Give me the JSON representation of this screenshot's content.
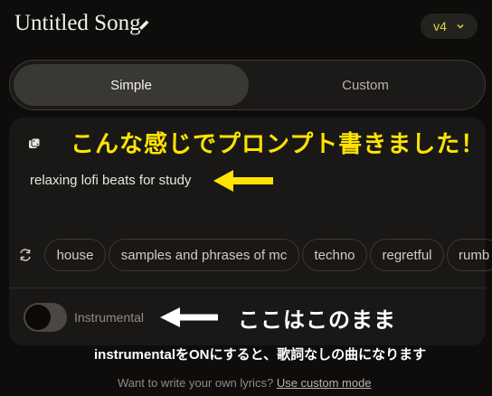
{
  "header": {
    "song_title": "Untitled Song",
    "edit_icon": "pencil-icon",
    "version": "v4",
    "version_icon": "chevron-down-icon"
  },
  "mode_tabs": {
    "simple_label": "Simple",
    "custom_label": "Custom",
    "active": "Simple"
  },
  "prompt": {
    "dice_icon": "dice-icon",
    "text": "relaxing lofi beats for study"
  },
  "style_tags": {
    "refresh_icon": "refresh-icon",
    "items": [
      "house",
      "samples and phrases of mc",
      "techno",
      "regretful",
      "rumb"
    ]
  },
  "instrumental": {
    "label": "Instrumental",
    "enabled": false
  },
  "footer": {
    "question": "Want to write your own lyrics?",
    "link": "Use custom mode"
  },
  "annotations": {
    "main": "こんな感じでプロンプト書きました！",
    "keep": "ここはこのまま",
    "note": "instrumentalをONにすると、歌詞なしの曲になります",
    "main_color": "#ffe400",
    "keep_color": "#ffffff"
  },
  "colors": {
    "background": "#0f0d0c",
    "panel": "#1a1816",
    "accent_version": "#d9d63a"
  }
}
